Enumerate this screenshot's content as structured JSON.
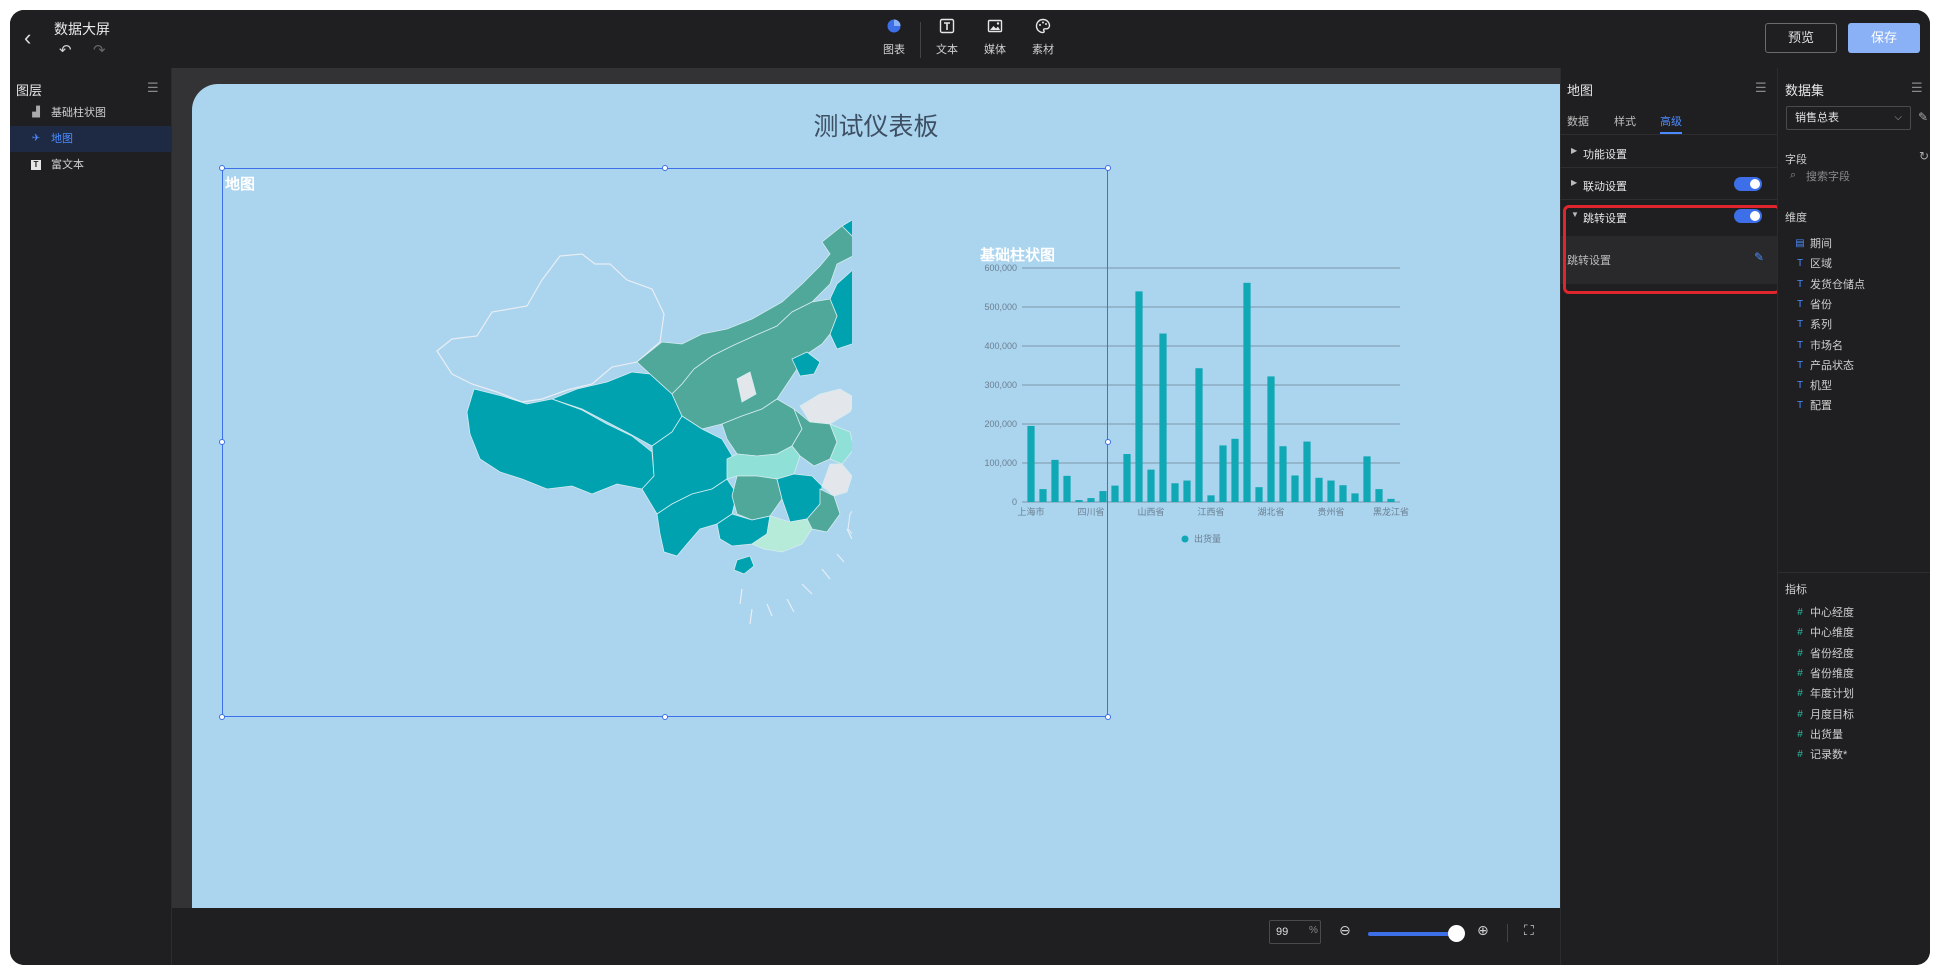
{
  "header": {
    "title": "数据大屏",
    "tools": [
      {
        "label": "图表",
        "icon": "chart-pie-icon"
      },
      {
        "label": "文本",
        "icon": "text-icon"
      },
      {
        "label": "媒体",
        "icon": "image-icon"
      },
      {
        "label": "素材",
        "icon": "palette-icon"
      }
    ],
    "preview_label": "预览",
    "save_label": "保存"
  },
  "layers": {
    "title": "图层",
    "items": [
      {
        "label": "基础柱状图",
        "icon": "bar-chart-icon",
        "active": false
      },
      {
        "label": "地图",
        "icon": "map-icon",
        "active": true
      },
      {
        "label": "富文本",
        "icon": "text-icon",
        "active": false
      }
    ]
  },
  "canvas": {
    "board_title": "测试仪表板",
    "map_title": "地图",
    "bar_title": "基础柱状图",
    "map_colors": {
      "dark": "#00a2b0",
      "mid": "#4fa89a",
      "light": "#8fe0d6",
      "pale": "#b6ead9",
      "none": "#e3e6ea"
    }
  },
  "chart_data": {
    "type": "bar",
    "title": "基础柱状图",
    "xlabel": "",
    "ylabel": "",
    "ylim": [
      0,
      600000
    ],
    "yticks": [
      "600,000",
      "500,000",
      "400,000",
      "300,000",
      "200,000",
      "100,000",
      "0"
    ],
    "tick_labels": [
      "上海市",
      "四川省",
      "山西省",
      "江西省",
      "湖北省",
      "贵州省",
      "黑龙江省"
    ],
    "legend": "出货量",
    "color": "#0fa8b4",
    "grid": true,
    "values": [
      195000,
      33000,
      108000,
      67000,
      5000,
      10000,
      28000,
      42000,
      123000,
      540000,
      83000,
      432000,
      48000,
      55000,
      343000,
      17000,
      145000,
      162000,
      562000,
      38000,
      322000,
      143000,
      68000,
      155000,
      62000,
      55000,
      43000,
      22000,
      117000,
      33000,
      8000
    ]
  },
  "bottom": {
    "zoom_value": "99",
    "zoom_unit": "%",
    "zoom_level": 0.9
  },
  "props": {
    "title": "地图",
    "tabs": [
      {
        "label": "数据",
        "active": false
      },
      {
        "label": "样式",
        "active": false
      },
      {
        "label": "高级",
        "active": true
      }
    ],
    "sections": [
      {
        "label": "功能设置",
        "expanded": false,
        "toggle": false
      },
      {
        "label": "联动设置",
        "expanded": false,
        "toggle": true
      },
      {
        "label": "跳转设置",
        "expanded": true,
        "toggle": true
      }
    ],
    "jump_sub_label": "跳转设置"
  },
  "dataset": {
    "title": "数据集",
    "selected": "销售总表",
    "fields_label": "字段",
    "search_placeholder": "搜索字段",
    "dimensions_label": "维度",
    "dimensions": [
      {
        "label": "期间",
        "type": "date"
      },
      {
        "label": "区域",
        "type": "text"
      },
      {
        "label": "发货仓储点",
        "type": "text"
      },
      {
        "label": "省份",
        "type": "text"
      },
      {
        "label": "系列",
        "type": "text"
      },
      {
        "label": "市场名",
        "type": "text"
      },
      {
        "label": "产品状态",
        "type": "text"
      },
      {
        "label": "机型",
        "type": "text"
      },
      {
        "label": "配置",
        "type": "text"
      }
    ],
    "measures_label": "指标",
    "measures": [
      {
        "label": "中心经度"
      },
      {
        "label": "中心维度"
      },
      {
        "label": "省份经度"
      },
      {
        "label": "省份维度"
      },
      {
        "label": "年度计划"
      },
      {
        "label": "月度目标"
      },
      {
        "label": "出货量"
      },
      {
        "label": "记录数*"
      }
    ]
  }
}
